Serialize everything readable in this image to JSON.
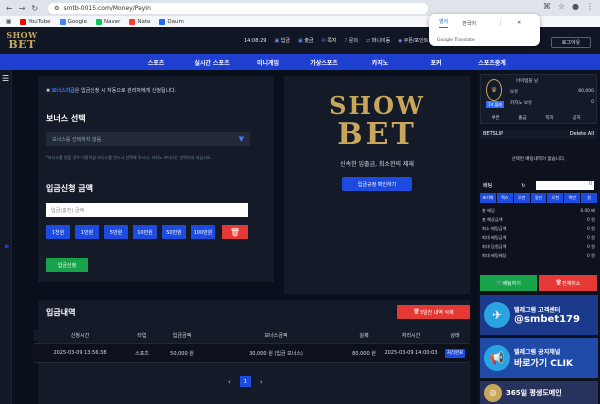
{
  "browser": {
    "url": "smtb-0015.com/Money/PayIn",
    "bookmarks": [
      "YouTube",
      "Google",
      "Naver",
      "Nate",
      "Daum"
    ]
  },
  "translate_popup": {
    "lang1": "영어",
    "lang2": "한국어",
    "footer": "Google Translate"
  },
  "header": {
    "logo_line1": "SHOW",
    "logo_line2": "BET",
    "util": [
      "14:08:29",
      "입금",
      "출금",
      "쪽지",
      "문의",
      "머니이동",
      "쿠폰/포인트"
    ],
    "login": "로그아웃"
  },
  "nav": [
    "스포츠",
    "실시간 스포츠",
    "미니게임",
    "가상스포츠",
    "카지노",
    "포커",
    "스포츠중계"
  ],
  "deposit": {
    "notice_highlight": "보너스지급",
    "notice_rest": "은 입금신청 시 자동으로 관리자에게 신청됩니다.",
    "bonus_title": "보너스 선택",
    "bonus_select": "보너스를 선택하지 않음.",
    "bonus_hint": "*보너스를 원할 경우 이용하실 보너스를 반드시 선택해 주시고, 카지노 보너스는 선택하지 마십시오.",
    "amount_title": "입금신청 금액",
    "amount_placeholder": "입금(충전) 금액",
    "chips": [
      "1천원",
      "1만원",
      "5만원",
      "10만원",
      "50만원",
      "100만원"
    ],
    "apply": "입금신청"
  },
  "promo": {
    "big1": "SHOW",
    "big2": "BET",
    "tagline": "신속한 입출금, 최소한의 제재",
    "rule_btn": "입금규정 확인하기"
  },
  "history": {
    "title": "입금내역",
    "delete_btn": "3일전 내역 삭제",
    "headers": [
      "신청시간",
      "타입",
      "입금금액",
      "보너스금액",
      "실제",
      "처리시간",
      "상태"
    ],
    "rows": [
      [
        "2025-03-09 13:56:38",
        "스포츠",
        "50,000 원",
        "30,000 원 (입금 보너스)",
        "80,000 원",
        "2025-03-09 14:00:03",
        "처리완료"
      ]
    ],
    "page": "1"
  },
  "user": {
    "name": "아이템플 님",
    "level": "1V 플레",
    "money_label": "보유",
    "money": "80,000",
    "casino_label": "카지노 보유",
    "casino": "0",
    "mini": [
      "쿠폰",
      "출금",
      "쪽지",
      "공지"
    ]
  },
  "betslip": {
    "title": "BETSLIP",
    "delete_all": "Delete All",
    "empty": "선택된 배팅내역이 없습니다.",
    "bet_label": "배팅",
    "bet_value": "0",
    "odds": [
      "초기화",
      "맥스",
      "오만",
      "일만",
      "오천",
      "백만",
      "원"
    ],
    "stats": [
      [
        "총 배당",
        "0.00 배"
      ],
      [
        "총 예상금액",
        "0 원"
      ],
      [
        "최소 배팅금액",
        "0 원"
      ],
      [
        "최대 배팅금액",
        "0 원"
      ],
      [
        "최대 당첨금액",
        "0 원"
      ],
      [
        "최대 배팅배당",
        "0 원"
      ]
    ],
    "bet_btn": "배팅하기",
    "cancel_btn": "전체취소"
  },
  "ads": [
    {
      "line1": "텔레그램 고객센터",
      "line2": "@smbet179"
    },
    {
      "line1": "텔레그램 공지채널",
      "line2": "바로가기 CLIK"
    },
    {
      "line1": "365일 평생도메인"
    }
  ]
}
